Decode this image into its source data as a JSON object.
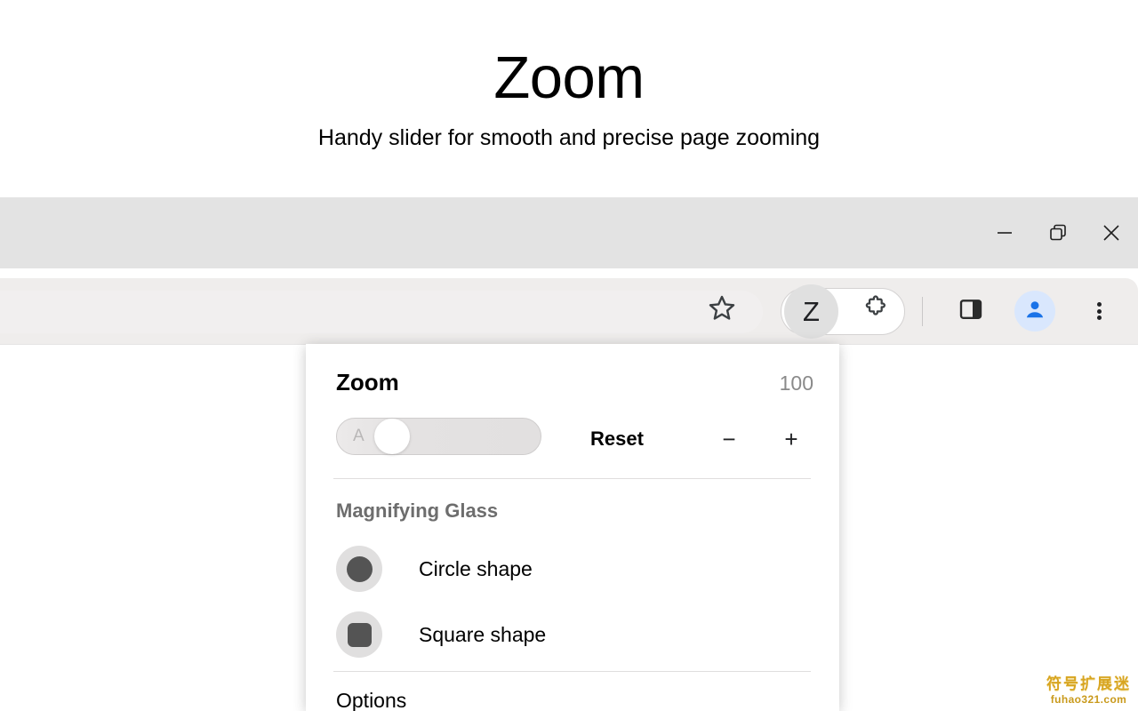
{
  "hero": {
    "title": "Zoom",
    "subtitle": "Handy slider for smooth and precise page zooming"
  },
  "window_controls": {
    "minimize": "minimize-icon",
    "restore": "restore-icon",
    "close": "close-icon"
  },
  "toolbar": {
    "bookmark_icon": "star-icon",
    "extension_badge_letter": "Z",
    "puzzle_icon": "puzzle-piece-icon",
    "side_panel_icon": "side-panel-icon",
    "avatar_icon": "user-avatar-icon",
    "menu_icon": "three-dot-menu-icon"
  },
  "popup": {
    "title": "Zoom",
    "zoom_value": "100",
    "slider": {
      "label": "A",
      "position_percent": 18
    },
    "reset_label": "Reset",
    "decrease_label": "−",
    "increase_label": "+",
    "magnifier_section_label": "Magnifying Glass",
    "shapes": [
      {
        "label": "Circle shape",
        "swatch": "circle-swatch"
      },
      {
        "label": "Square shape",
        "swatch": "square-swatch"
      }
    ],
    "options_label": "Options"
  },
  "watermark": {
    "chinese": "符号扩展迷",
    "url": "fuhao321.com"
  },
  "colors": {
    "titlebar": "#e3e3e3",
    "toolbar": "#efedec",
    "avatar_blue": "#1a73e8",
    "avatar_bg": "#d9e7fd",
    "value_gray": "#8a8a8a",
    "section_gray": "#6d6d6d",
    "swatch_bg": "#e0dfdf",
    "swatch_fg": "#545454",
    "watermark_gold": "#d8a521"
  }
}
